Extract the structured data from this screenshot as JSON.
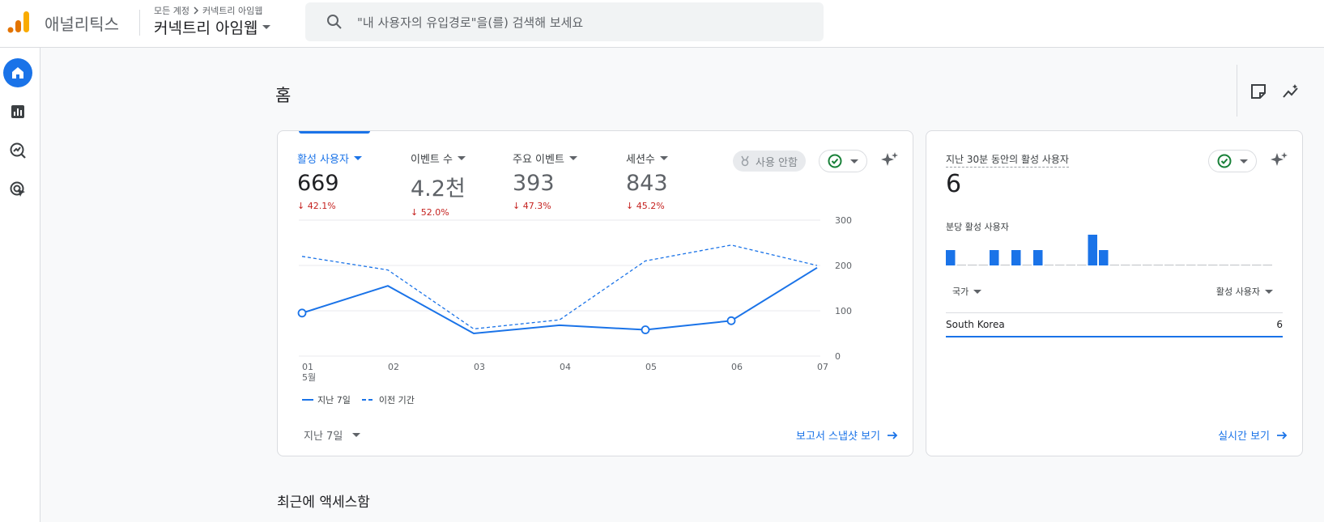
{
  "header": {
    "app_name": "애널리틱스",
    "breadcrumb_root": "모든 계정",
    "breadcrumb_child": "커넥트리 아임웹",
    "property_name": "커넥트리 아임웹",
    "search_placeholder": "\"내 사용자의 유입경로\"을(를) 검색해 보세요"
  },
  "nav": {
    "items": [
      "home-icon",
      "reports-icon",
      "explore-icon",
      "advertising-icon"
    ]
  },
  "page": {
    "title": "홈",
    "section_recent": "최근에 액세스함"
  },
  "main_card": {
    "metrics": [
      {
        "label": "활성 사용자",
        "value": "669",
        "delta": "42.1%"
      },
      {
        "label": "이벤트 수",
        "value": "4.2천",
        "delta": "52.0%"
      },
      {
        "label": "주요 이벤트",
        "value": "393",
        "delta": "47.3%"
      },
      {
        "label": "세션수",
        "value": "843",
        "delta": "45.2%"
      }
    ],
    "disabled_label": "사용 안함",
    "legend_current": "지난 7일",
    "legend_previous": "이전 기간",
    "period_select": "지난 7일",
    "link": "보고서 스냅샷 보기"
  },
  "chart_data": {
    "type": "line",
    "x": [
      "01",
      "02",
      "03",
      "04",
      "05",
      "06",
      "07"
    ],
    "x_sub": [
      "5월",
      "",
      "",
      "",
      "",
      "",
      ""
    ],
    "ylim": [
      0,
      300
    ],
    "yticks": [
      "300",
      "200",
      "100",
      "0"
    ],
    "series": [
      {
        "name": "지난 7일",
        "style": "solid",
        "values": [
          95,
          155,
          50,
          68,
          58,
          78,
          195
        ]
      },
      {
        "name": "이전 기간",
        "style": "dashed",
        "values": [
          220,
          190,
          60,
          80,
          210,
          245,
          200
        ]
      }
    ],
    "colors": {
      "line": "#1a73e8",
      "grid": "#e8eaed"
    }
  },
  "realtime_card": {
    "label": "지난 30분 동안의 활성 사용자",
    "value": "6",
    "sub_label": "분당 활성 사용자",
    "per_minute": [
      1,
      0,
      0,
      0,
      1,
      0,
      1,
      0,
      1,
      0,
      0,
      0,
      0,
      2,
      1,
      0,
      0,
      0,
      0,
      0,
      0,
      0,
      0,
      0,
      0,
      0,
      0,
      0,
      0,
      0
    ],
    "table_col1": "국가",
    "table_col2": "활성 사용자",
    "rows": [
      {
        "country": "South Korea",
        "users": "6"
      }
    ],
    "link": "실시간 보기"
  }
}
